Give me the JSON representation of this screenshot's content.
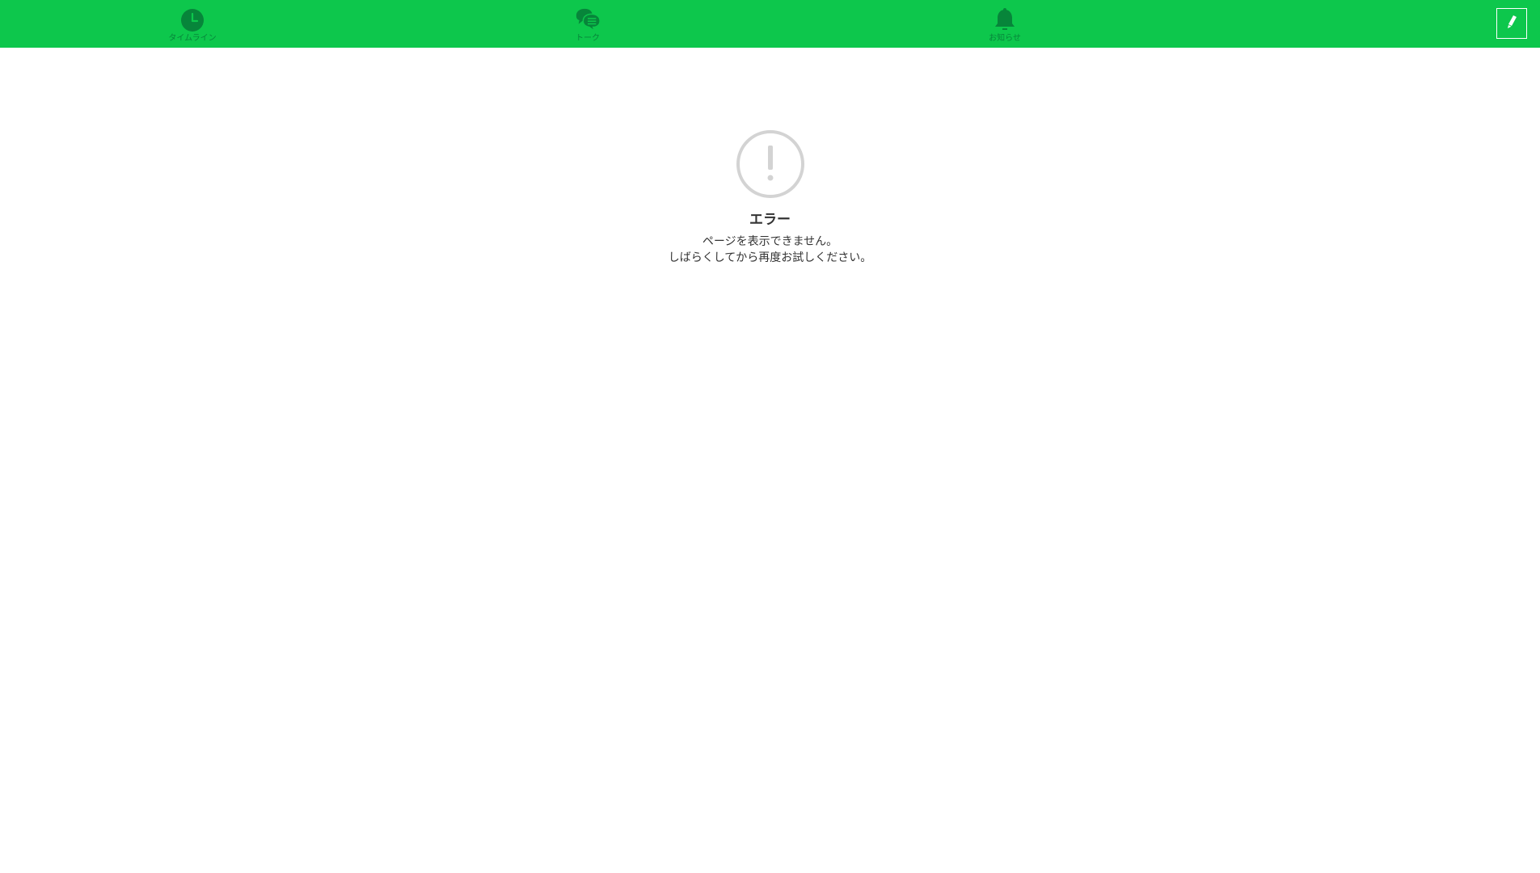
{
  "header": {
    "background_color": "#0dc74c",
    "tabs": [
      {
        "label": "タイムライン",
        "icon": "clock-icon"
      },
      {
        "label": "トーク",
        "icon": "chat-bubbles-icon"
      },
      {
        "label": "お知らせ",
        "icon": "bell-icon"
      }
    ],
    "compose_icon": "pencil-icon"
  },
  "empty_state": {
    "icon": "exclamation-circle-icon",
    "title": "エラー",
    "line1": "ページを表示できません。",
    "line2": "しばらくしてから再度お試しください。"
  }
}
